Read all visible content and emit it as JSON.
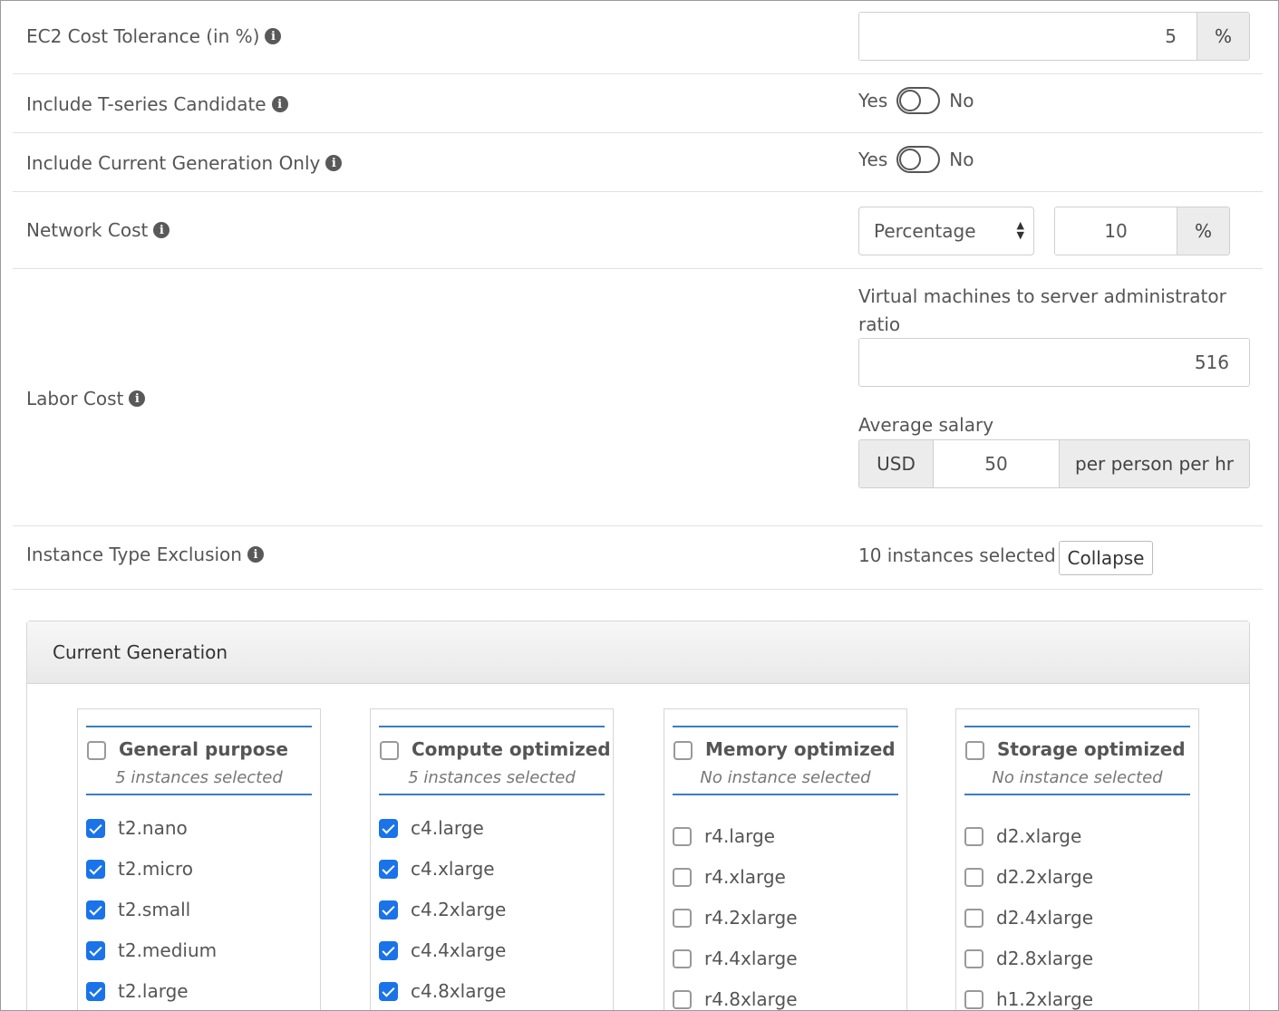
{
  "ec2_cost_tolerance": {
    "label": "EC2 Cost Tolerance (in %)",
    "value": "5",
    "unit": "%"
  },
  "t_series": {
    "label": "Include T-series Candidate",
    "yes": "Yes",
    "no": "No"
  },
  "current_generation_only": {
    "label": "Include Current Generation Only",
    "yes": "Yes",
    "no": "No"
  },
  "network_cost": {
    "label": "Network Cost",
    "type": "Percentage",
    "value": "10",
    "unit": "%"
  },
  "labor_cost": {
    "label": "Labor Cost",
    "ratio_label": "Virtual machines to server administrator ratio",
    "ratio_value": "516",
    "salary_label": "Average salary",
    "currency": "USD",
    "salary_value": "50",
    "salary_unit": "per person per hr"
  },
  "instance_exclusion": {
    "label": "Instance Type Exclusion",
    "summary": "10 instances selected",
    "collapse": "Collapse"
  },
  "panel": {
    "title": "Current Generation",
    "groups": [
      {
        "title": "General purpose",
        "subtitle": "5 instances selected",
        "items": [
          {
            "name": "t2.nano",
            "checked": true
          },
          {
            "name": "t2.micro",
            "checked": true
          },
          {
            "name": "t2.small",
            "checked": true
          },
          {
            "name": "t2.medium",
            "checked": true
          },
          {
            "name": "t2.large",
            "checked": true
          }
        ]
      },
      {
        "title": "Compute optimized",
        "subtitle": "5 instances selected",
        "items": [
          {
            "name": "c4.large",
            "checked": true
          },
          {
            "name": "c4.xlarge",
            "checked": true
          },
          {
            "name": "c4.2xlarge",
            "checked": true
          },
          {
            "name": "c4.4xlarge",
            "checked": true
          },
          {
            "name": "c4.8xlarge",
            "checked": true
          }
        ]
      },
      {
        "title": "Memory optimized",
        "subtitle": "No instance selected",
        "items": [
          {
            "name": "r4.large",
            "checked": false
          },
          {
            "name": "r4.xlarge",
            "checked": false
          },
          {
            "name": "r4.2xlarge",
            "checked": false
          },
          {
            "name": "r4.4xlarge",
            "checked": false
          },
          {
            "name": "r4.8xlarge",
            "checked": false
          }
        ]
      },
      {
        "title": "Storage optimized",
        "subtitle": "No instance selected",
        "items": [
          {
            "name": "d2.xlarge",
            "checked": false
          },
          {
            "name": "d2.2xlarge",
            "checked": false
          },
          {
            "name": "d2.4xlarge",
            "checked": false
          },
          {
            "name": "d2.8xlarge",
            "checked": false
          },
          {
            "name": "h1.2xlarge",
            "checked": false
          }
        ]
      }
    ]
  }
}
